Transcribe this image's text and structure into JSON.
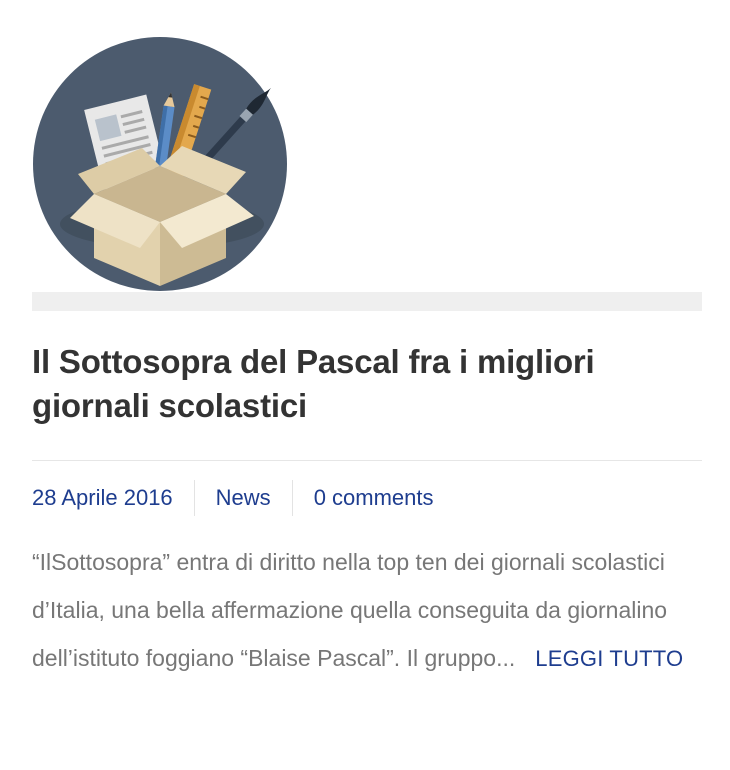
{
  "post": {
    "thumbnail_icon": "open-box-with-school-supplies-icon",
    "title": "Il Sottosopra del Pascal fra i migliori giornali scolastici",
    "meta": {
      "date": "28 Aprile 2016",
      "category": "News",
      "comments": "0 comments"
    },
    "excerpt": "“IlSottosopra” entra di diritto nella top ten dei giornali scolastici d’Italia, una bella affermazione quella conseguita da giornalino dell’istituto foggiano “Blaise Pascal”. Il gruppo...",
    "read_more": "LEGGI TUTTO"
  },
  "colors": {
    "link": "#1e3d8f",
    "title": "#333333",
    "excerpt": "#777777",
    "thumb_bg": "#4c5b6e"
  }
}
